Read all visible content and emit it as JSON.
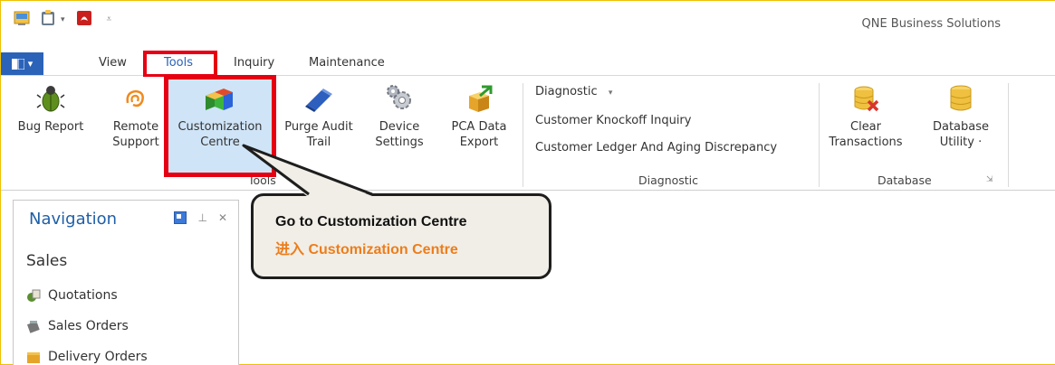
{
  "window": {
    "title": "QNE Business Solutions"
  },
  "menu": {
    "tabs": [
      {
        "label": "View"
      },
      {
        "label": "Tools",
        "active": true
      },
      {
        "label": "Inquiry"
      },
      {
        "label": "Maintenance"
      }
    ]
  },
  "ribbon": {
    "tools": [
      {
        "label1": "Bug Report",
        "label2": "",
        "icon": "bug-icon"
      },
      {
        "label1": "Remote",
        "label2": "Support",
        "icon": "remote-support-icon"
      },
      {
        "label1": "Customization",
        "label2": "Centre",
        "icon": "customization-cubes-icon"
      },
      {
        "label1": "Purge Audit",
        "label2": "Trail",
        "icon": "eraser-icon"
      },
      {
        "label1": "Device",
        "label2": "Settings",
        "icon": "gear-icon"
      },
      {
        "label1": "PCA Data",
        "label2": "Export",
        "icon": "export-box-icon"
      }
    ],
    "tools_group_label": "Tools",
    "diagnostic_items": [
      "Diagnostic",
      "Customer Knockoff Inquiry",
      "Customer Ledger And Aging Discrepancy"
    ],
    "diagnostic_group_label": "Diagnostic",
    "database": [
      {
        "label1": "Clear",
        "label2": "Transactions",
        "icon": "database-delete-icon"
      },
      {
        "label1": "Database",
        "label2": "Utility ·",
        "icon": "database-icon"
      }
    ],
    "database_group_label": "Database"
  },
  "navigation": {
    "title": "Navigation",
    "section": "Sales",
    "items": [
      {
        "label": "Quotations",
        "icon": "quotation-icon"
      },
      {
        "label": "Sales Orders",
        "icon": "sales-order-icon"
      },
      {
        "label": "Delivery Orders",
        "icon": "delivery-order-icon"
      }
    ]
  },
  "callout": {
    "line1": "Go to Customization Centre",
    "line2": "进入 Customization Centre"
  },
  "colors": {
    "accent": "#2b63b8",
    "highlight_red": "#e60012",
    "callout_orange": "#ed7d1b"
  }
}
